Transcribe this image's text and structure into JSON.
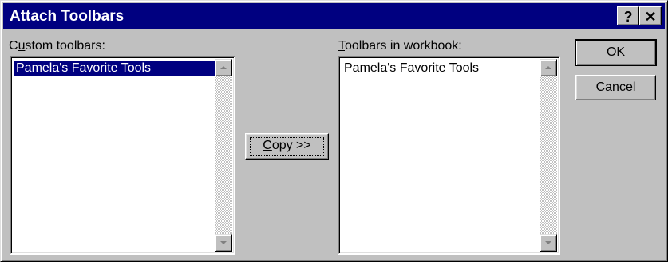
{
  "window": {
    "title": "Attach Toolbars",
    "help_glyph": "?",
    "close_glyph": "✕"
  },
  "custom_toolbars": {
    "label_access_key": "u",
    "label_before": "C",
    "label_after": "stom toolbars:",
    "items": [
      {
        "label": "Pamela's Favorite Tools",
        "selected": true
      }
    ]
  },
  "toolbars_in_workbook": {
    "label_access_key": "T",
    "label_after": "oolbars in workbook:",
    "items": [
      {
        "label": "Pamela's Favorite Tools",
        "selected": false
      }
    ]
  },
  "buttons": {
    "copy_access_key": "C",
    "copy_rest": "opy >>",
    "ok": "OK",
    "cancel": "Cancel"
  },
  "icons": {
    "scroll_up": "scroll-up-arrow-icon",
    "scroll_down": "scroll-down-arrow-icon",
    "help": "help-icon",
    "close": "close-icon"
  },
  "colors": {
    "titlebar": "#000080",
    "face": "#c0c0c0",
    "selection": "#000080"
  }
}
